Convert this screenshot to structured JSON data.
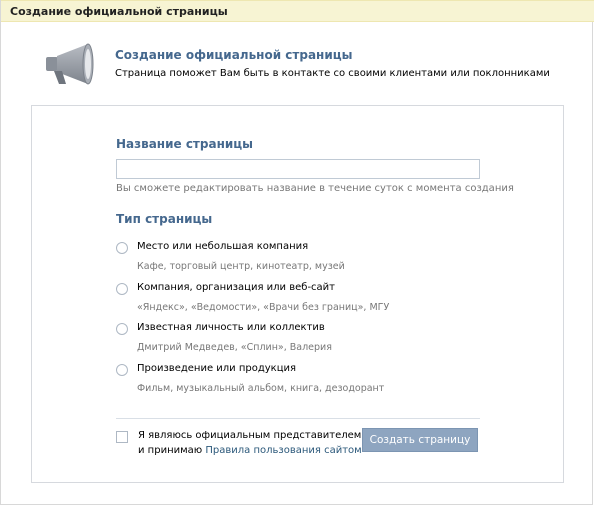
{
  "window": {
    "title": "Создание официальной страницы"
  },
  "header": {
    "icon": "megaphone-icon",
    "title": "Создание официальной страницы",
    "description": "Страница поможет Вам быть в контакте со своими клиентами или поклонниками"
  },
  "form": {
    "name_label": "Название страницы",
    "name_value": "",
    "name_hint": "Вы сможете редактировать название в течение суток с момента создания",
    "type_label": "Тип страницы",
    "options": [
      {
        "label": "Место или небольшая компания",
        "sub": "Кафе, торговый центр, кинотеатр, музей"
      },
      {
        "label": "Компания, организация или веб-сайт",
        "sub": "«Яндекс», «Ведомости», «Врачи без границ», МГУ"
      },
      {
        "label": "Известная личность или коллектив",
        "sub": "Дмитрий Медведев, «Сплин», Валерия"
      },
      {
        "label": "Произведение или продукция",
        "sub": "Фильм, музыкальный альбом, книга, дезодорант"
      }
    ],
    "agree_line1": "Я являюсь официальным представителем",
    "agree_prefix": "и принимаю ",
    "agree_link": "Правила пользования сайтом",
    "submit_label": "Создать страницу"
  },
  "colors": {
    "title_bar": "#f7f4d3",
    "accent": "#45688e",
    "button": "#8ea5c0",
    "link": "#2b587a"
  }
}
